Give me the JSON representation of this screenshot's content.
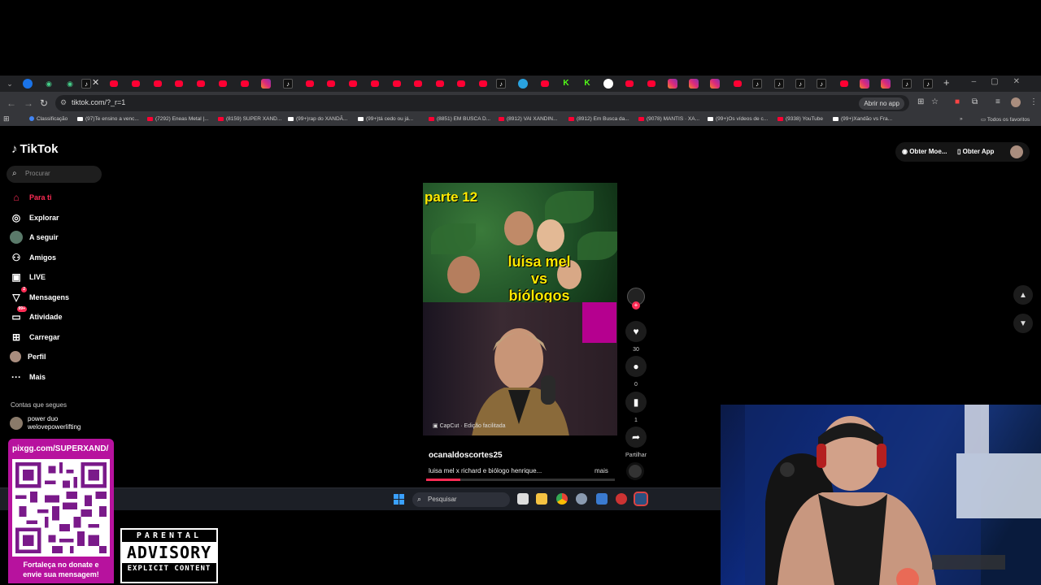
{
  "browser": {
    "url": "tiktok.com/?_r=1",
    "open_in_app": "Abrir no app",
    "bookmarks": [
      "Classificação",
      "(97)Te ensino a venc...",
      "(7292) Eneas Metal |...",
      "(8159) SUPER XAND...",
      "(99+)rap do XANDÃ...",
      "(99+)tá cedo ou já...",
      "(8851) EM BUSCA D...",
      "(8912) VAI XANDIN...",
      "(8912) Em Busca da...",
      "(9078) MANTIS · XA...",
      "(99+)Os vídeos de c...",
      "(9338) YouTube",
      "(99+)Xandão vs Fra..."
    ],
    "all_favorites": "Todos os favoritos"
  },
  "tiktok": {
    "logo": "TikTok",
    "search_placeholder": "Procurar",
    "nav": [
      {
        "label": "Para ti",
        "icon": "home-icon"
      },
      {
        "label": "Explorar",
        "icon": "compass-icon"
      },
      {
        "label": "A seguir",
        "icon": "following-icon"
      },
      {
        "label": "Amigos",
        "icon": "friends-icon"
      },
      {
        "label": "LIVE",
        "icon": "live-icon"
      },
      {
        "label": "Mensagens",
        "icon": "messages-icon",
        "badge": "2"
      },
      {
        "label": "Atividade",
        "icon": "activity-icon",
        "badge": "99+"
      },
      {
        "label": "Carregar",
        "icon": "upload-icon"
      },
      {
        "label": "Perfil",
        "icon": "profile-icon"
      },
      {
        "label": "Mais",
        "icon": "more-icon"
      }
    ],
    "follows_title": "Contas que segues",
    "follow": {
      "name": "power duo",
      "handle": "welovepowerlifting"
    },
    "get_coins": "Obter Moe...",
    "get_app": "Obter App",
    "video": {
      "title": "parte 12",
      "overlay_line1": "luisa mel",
      "overlay_line2": "vs",
      "overlay_line3": "biólogos",
      "capcut": "CapCut · Edição facilitada",
      "creator": "ocanaldoscortes25",
      "caption": "luisa mel x richard e biólogo henrique...",
      "more": "mais",
      "progress": 0.18
    },
    "actions": {
      "likes": "30",
      "comments": "0",
      "saves": "1",
      "share": "Partilhar"
    }
  },
  "taskbar": {
    "search_placeholder": "Pesquisar"
  },
  "stream_overlay": {
    "qr_url": "pixgg.com/SUPERXAND/",
    "qr_message_line1": "Fortaleça no donate e",
    "qr_message_line2": "envie sua mensagem!",
    "advisory_top": "PARENTAL",
    "advisory_mid": "ADVISORY",
    "advisory_bot": "EXPLICIT CONTENT"
  },
  "colors": {
    "accent": "#fe2c55",
    "qr_card": "#b7129e",
    "video_text": "#ffea00"
  }
}
